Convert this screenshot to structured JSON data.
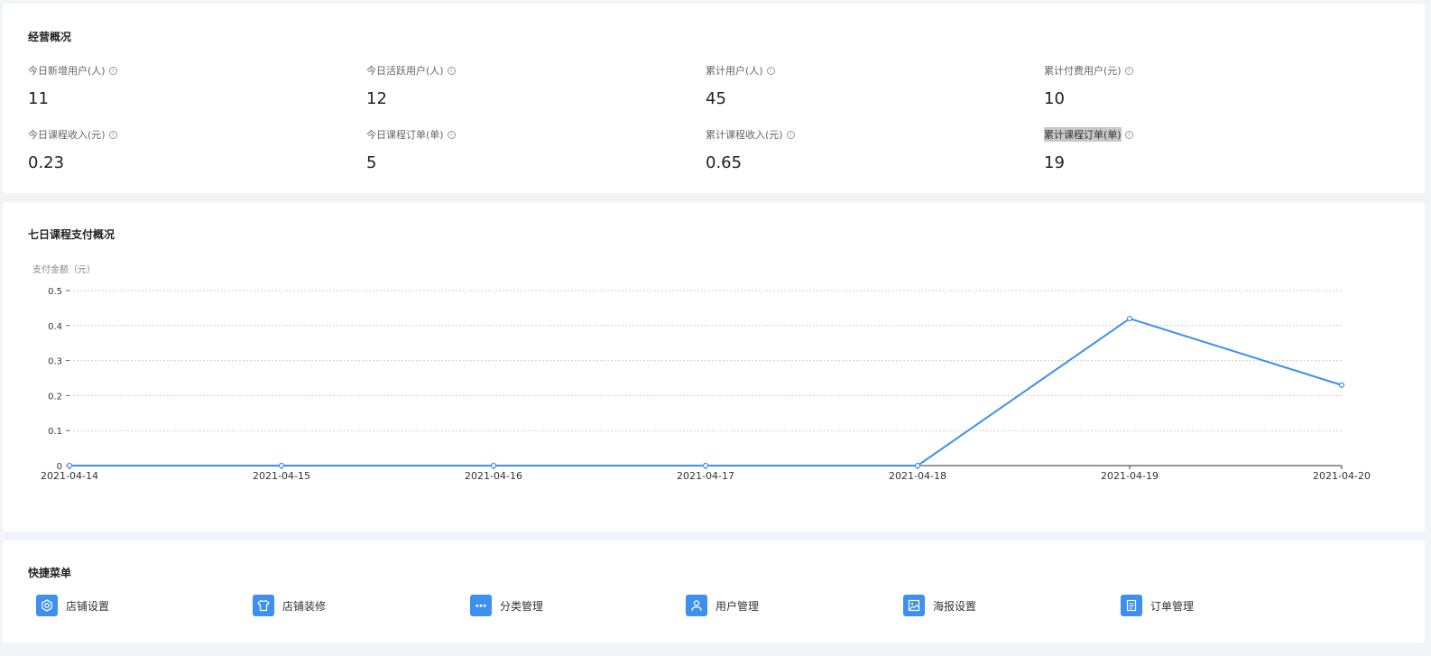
{
  "overview": {
    "title": "经营概况",
    "stats": [
      {
        "label": "今日新增用户(人)",
        "value": "11"
      },
      {
        "label": "今日活跃用户(人)",
        "value": "12"
      },
      {
        "label": "累计用户(人)",
        "value": "45"
      },
      {
        "label": "累计付费用户(元)",
        "value": "10"
      },
      {
        "label": "今日课程收入(元)",
        "value": "0.23"
      },
      {
        "label": "今日课程订单(单)",
        "value": "5"
      },
      {
        "label": "累计课程收入(元)",
        "value": "0.65"
      },
      {
        "label": "累计课程订单(单)",
        "value": "19"
      }
    ],
    "info_glyph": "i"
  },
  "chart_section": {
    "title": "七日课程支付概况"
  },
  "chart_data": {
    "type": "line",
    "ylabel": "支付金额（元）",
    "categories": [
      "2021-04-14",
      "2021-04-15",
      "2021-04-16",
      "2021-04-17",
      "2021-04-18",
      "2021-04-19",
      "2021-04-20"
    ],
    "values": [
      0,
      0,
      0,
      0,
      0,
      0.42,
      0.23
    ],
    "ylim": [
      0,
      0.5
    ],
    "yticks": [
      "0",
      "0.1",
      "0.2",
      "0.3",
      "0.4",
      "0.5"
    ],
    "grid": true,
    "line_color": "#3d8ff0"
  },
  "menu": {
    "title": "快捷菜单",
    "items": [
      {
        "label": "店铺设置",
        "icon": "gear-icon"
      },
      {
        "label": "店铺装修",
        "icon": "shirt-icon"
      },
      {
        "label": "分类管理",
        "icon": "dots-icon"
      },
      {
        "label": "用户管理",
        "icon": "user-icon"
      },
      {
        "label": "海报设置",
        "icon": "image-icon"
      },
      {
        "label": "订单管理",
        "icon": "document-icon"
      }
    ],
    "accent_color": "#3d8ff0"
  }
}
